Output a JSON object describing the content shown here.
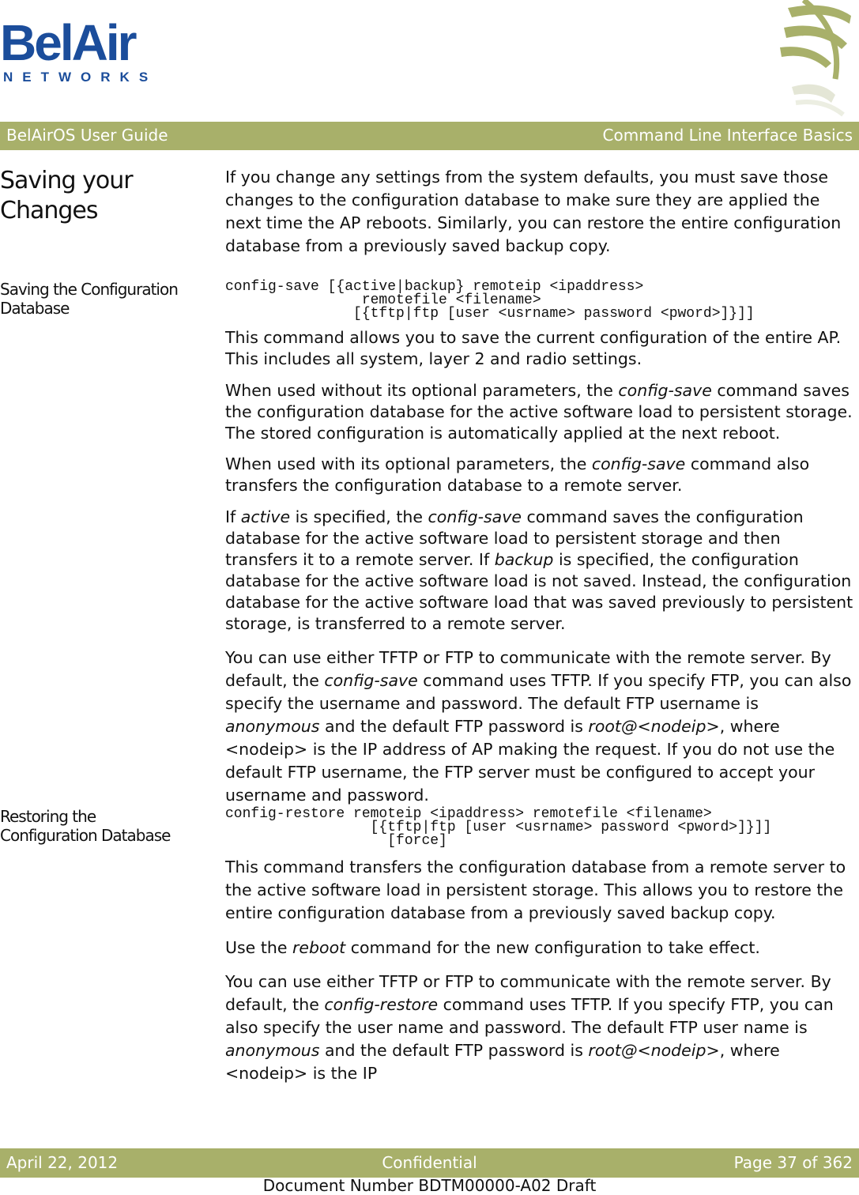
{
  "logo": {
    "main": "BelAir",
    "sub": "NETWORKS"
  },
  "header": {
    "left": "BelAirOS User Guide",
    "right": "Command Line Interface Basics"
  },
  "sections": {
    "saving_changes": {
      "title_line1": "Saving your",
      "title_line2": "Changes",
      "paragraph": "If you change any settings from the system defaults, you must save those changes to the configuration database to make sure they are applied the next time the AP reboots. Similarly, you can restore the entire configuration database from a previously saved backup copy."
    },
    "saving_db": {
      "title_line1": "Saving the Configuration",
      "title_line2": "Database",
      "code": "config-save [{active|backup} remoteip <ipaddress>\n                remotefile <filename>\n               [{tftp|ftp [user <usrname> password <pword>]}]]",
      "p1": "This command allows you to save the current configuration of the entire AP. This includes all system, layer 2 and radio settings.",
      "p2": {
        "a": "When used without its optional parameters, the ",
        "b": "config-save",
        "c": " command saves the configuration database for the active software load to persistent storage. The stored configuration is automatically applied at the next reboot."
      },
      "p3": {
        "a": "When used with its optional parameters, the ",
        "b": "config-save",
        "c": " command also transfers the configuration database to a remote server."
      },
      "p4": {
        "a": "If ",
        "b": "active",
        "c": " is specified, the ",
        "d": "config-save",
        "e": " command saves the configuration database for the active software load to persistent storage and then transfers it to a remote server. If ",
        "f": "backup",
        "g": " is specified, the configuration database for the active software load is not saved. Instead, the configuration database for the active software load that was saved previously to persistent storage, is transferred to a remote server."
      },
      "p5": {
        "a": "You can use either TFTP or FTP to communicate with the remote server. By default, the ",
        "b": "config-save",
        "c": " command uses TFTP. If you specify FTP, you can also specify the username and password. The default FTP username is ",
        "d": "anonymous",
        "e": " and the default FTP password is ",
        "f": "root@<nodeip>",
        "g": ", where <nodeip> is the IP address of AP making the request. If you do not use the default FTP username, the FTP server must be configured to accept your username and password."
      }
    },
    "restoring_db": {
      "title_line1": "Restoring the",
      "title_line2": "Configuration Database",
      "code": "config-restore remoteip <ipaddress> remotefile <filename>\n                 [{tftp|ftp [user <usrname> password <pword>]}]]\n                   [force]",
      "p1": "This command transfers the configuration database from a remote server to the active software load in persistent storage. This allows you to restore the entire configuration database from a previously saved backup copy.",
      "p2": {
        "a": "Use the ",
        "b": "reboot",
        "c": " command for the new configuration to take effect."
      },
      "p3": {
        "a": "You can use either TFTP or FTP to communicate with the remote server. By default, the ",
        "b": "config-restore",
        "c": " command uses TFTP. If you specify FTP, you can also specify the user name and password. The default FTP user name is ",
        "d": "anonymous",
        "e": " and the default FTP password is ",
        "f": "root@<nodeip>",
        "g": ", where <nodeip> is the IP"
      }
    }
  },
  "footer": {
    "date": "April 22, 2012",
    "center": "Confidential",
    "page": "Page 37 of 362",
    "doc_number": "Document Number BDTM00000-A02 Draft"
  },
  "colors": {
    "brand_blue": "#1b4d9b",
    "bar_green": "#a8b06a"
  }
}
